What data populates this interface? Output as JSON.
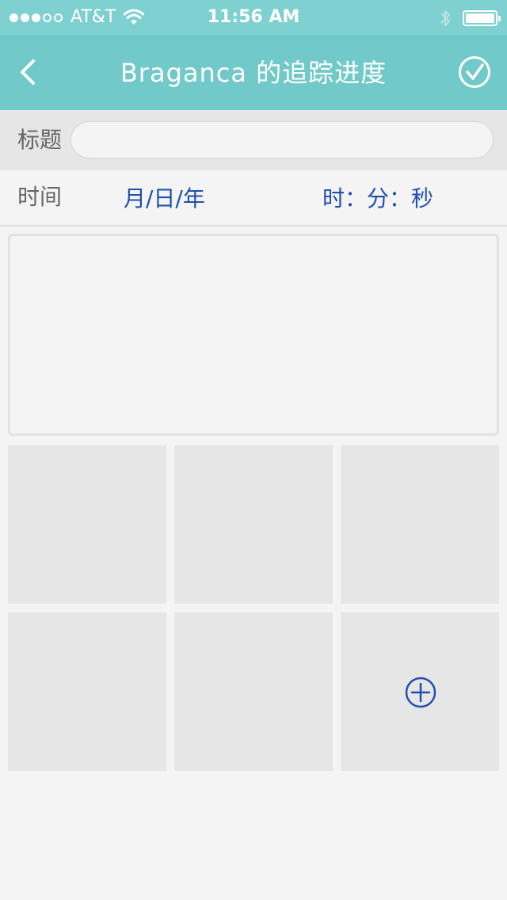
{
  "status_bar": {
    "carrier": "AT&T",
    "time": "11:56 AM",
    "signal_bars_filled": 3,
    "signal_bars_total": 5
  },
  "nav": {
    "title": "Braganca 的追踪进度",
    "back_icon": "chevron-left-icon",
    "confirm_icon": "check-circle-icon"
  },
  "form": {
    "title_label": "标题",
    "title_value": "",
    "title_placeholder": "",
    "time_label": "时间",
    "date_placeholder": "月/日/年",
    "time_placeholder": "时：分：秒",
    "content_value": ""
  },
  "photos": {
    "add_icon": "plus-circle-icon",
    "slot_count": 6
  },
  "colors": {
    "status_bar_bg": "#7fd0d1",
    "nav_bg": "#72c9c9",
    "accent_blue": "#1f4fb0",
    "placeholder_gray": "#e6e6e6",
    "page_bg": "#f4f4f4"
  }
}
